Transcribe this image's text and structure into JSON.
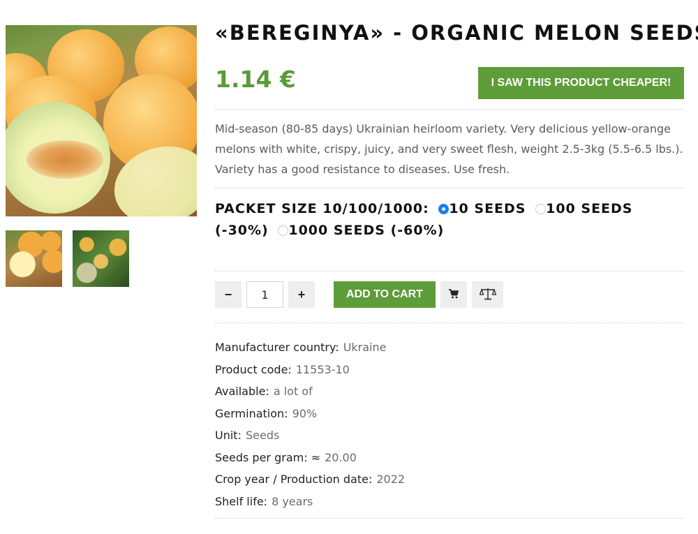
{
  "product": {
    "title": "«BEREGINYA» - ORGANIC MELON SEEDS",
    "price": "1.14 €",
    "cheaper_label": "I SAW THIS PRODUCT CHEAPER!",
    "description": "Mid-season (80-85 days) Ukrainian heirloom variety. Very delicious yellow-orange melons with white, crispy, juicy, and very sweet flesh, weight 2.5-3kg (5.5-6.5 lbs.). Variety has a good resistance to diseases. Use fresh."
  },
  "packet": {
    "label": "PACKET SIZE 10/100/1000:",
    "options": [
      {
        "label": "10 SEEDS",
        "checked": true
      },
      {
        "label": "100 SEEDS (-30%)",
        "checked": false
      },
      {
        "label": "1000 SEEDS (-60%)",
        "checked": false
      }
    ]
  },
  "cart": {
    "minus": "−",
    "quantity": "1",
    "plus": "+",
    "add_label": "ADD TO CART"
  },
  "specs": [
    {
      "label": "Manufacturer country:",
      "value": "Ukraine"
    },
    {
      "label": "Product code:",
      "value": "11553-10"
    },
    {
      "label": "Available:",
      "value": "a lot of"
    },
    {
      "label": "Germination:",
      "value": "90%"
    },
    {
      "label": "Unit:",
      "value": "Seeds"
    },
    {
      "label": "Seeds per gram: ≈",
      "value": "20.00"
    },
    {
      "label": "Crop year / Production date:",
      "value": "2022"
    },
    {
      "label": "Shelf life:",
      "value": "8 years"
    }
  ],
  "colors": {
    "accent_green": "#5f9c3a",
    "price_green": "#5b9a3a",
    "radio_blue": "#1a7ef2"
  },
  "icons": {
    "cart": "shopping-cart-icon",
    "compare": "scales-icon"
  }
}
